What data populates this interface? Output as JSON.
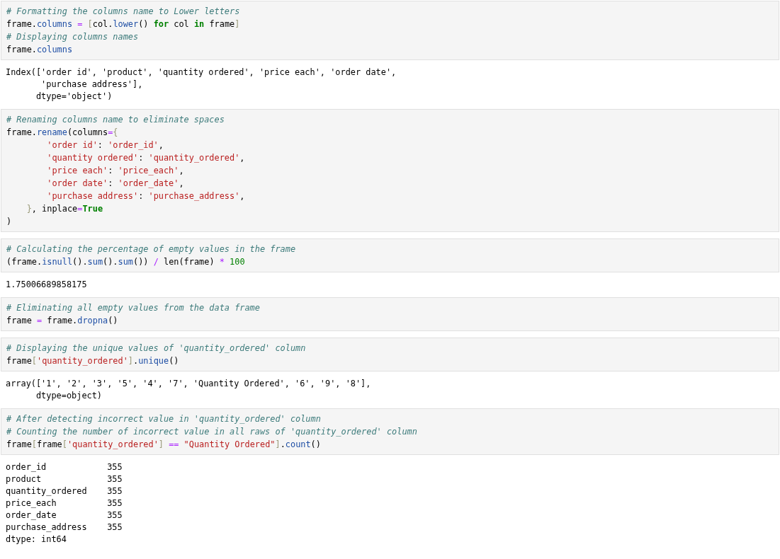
{
  "cells": [
    {
      "kind": "code",
      "lines": [
        [
          {
            "kind": "comment",
            "text": "# Formatting the columns name to Lower letters"
          }
        ],
        [
          {
            "kind": "text",
            "text": "frame."
          },
          {
            "kind": "attr",
            "text": "columns"
          },
          {
            "kind": "op",
            "text": " = "
          },
          {
            "kind": "bracket",
            "text": "["
          },
          {
            "kind": "text",
            "text": "col."
          },
          {
            "kind": "attr",
            "text": "lower"
          },
          {
            "kind": "text",
            "text": "() "
          },
          {
            "kind": "keyword",
            "text": "for"
          },
          {
            "kind": "text",
            "text": " col "
          },
          {
            "kind": "keyword",
            "text": "in"
          },
          {
            "kind": "text",
            "text": " frame"
          },
          {
            "kind": "bracket",
            "text": "]"
          }
        ],
        [
          {
            "kind": "comment",
            "text": "# Displaying columns names"
          }
        ],
        [
          {
            "kind": "text",
            "text": "frame."
          },
          {
            "kind": "attr",
            "text": "columns"
          }
        ]
      ]
    },
    {
      "kind": "output",
      "lines": [
        "Index(['order id', 'product', 'quantity ordered', 'price each', 'order date',",
        "       'purchase address'],",
        "      dtype='object')"
      ]
    },
    {
      "kind": "code",
      "lines": [
        [
          {
            "kind": "comment",
            "text": "# Renaming columns name to eliminate spaces"
          }
        ],
        [
          {
            "kind": "text",
            "text": "frame."
          },
          {
            "kind": "attr",
            "text": "rename"
          },
          {
            "kind": "text",
            "text": "(columns"
          },
          {
            "kind": "op",
            "text": "="
          },
          {
            "kind": "bracket",
            "text": "{"
          }
        ],
        [
          {
            "kind": "string",
            "text": "        'order id'"
          },
          {
            "kind": "text",
            "text": ": "
          },
          {
            "kind": "string",
            "text": "'order_id'"
          },
          {
            "kind": "text",
            "text": ","
          }
        ],
        [
          {
            "kind": "string",
            "text": "        'quantity ordered'"
          },
          {
            "kind": "text",
            "text": ": "
          },
          {
            "kind": "string",
            "text": "'quantity_ordered'"
          },
          {
            "kind": "text",
            "text": ","
          }
        ],
        [
          {
            "kind": "string",
            "text": "        'price each'"
          },
          {
            "kind": "text",
            "text": ": "
          },
          {
            "kind": "string",
            "text": "'price_each'"
          },
          {
            "kind": "text",
            "text": ","
          }
        ],
        [
          {
            "kind": "string",
            "text": "        'order date'"
          },
          {
            "kind": "text",
            "text": ": "
          },
          {
            "kind": "string",
            "text": "'order_date'"
          },
          {
            "kind": "text",
            "text": ","
          }
        ],
        [
          {
            "kind": "string",
            "text": "        'purchase address'"
          },
          {
            "kind": "text",
            "text": ": "
          },
          {
            "kind": "string",
            "text": "'purchase_address'"
          },
          {
            "kind": "text",
            "text": ","
          }
        ],
        [
          {
            "kind": "bracket",
            "text": "    }"
          },
          {
            "kind": "text",
            "text": ", inplace"
          },
          {
            "kind": "op",
            "text": "="
          },
          {
            "kind": "keyword",
            "text": "True"
          }
        ],
        [
          {
            "kind": "text",
            "text": ")"
          }
        ]
      ]
    },
    {
      "kind": "code",
      "lines": [
        [
          {
            "kind": "comment",
            "text": "# Calculating the percentage of empty values in the frame"
          }
        ],
        [
          {
            "kind": "text",
            "text": "(frame."
          },
          {
            "kind": "attr",
            "text": "isnull"
          },
          {
            "kind": "text",
            "text": "()."
          },
          {
            "kind": "attr",
            "text": "sum"
          },
          {
            "kind": "text",
            "text": "()."
          },
          {
            "kind": "attr",
            "text": "sum"
          },
          {
            "kind": "text",
            "text": "()) "
          },
          {
            "kind": "op",
            "text": "/"
          },
          {
            "kind": "text",
            "text": " len(frame) "
          },
          {
            "kind": "op",
            "text": "*"
          },
          {
            "kind": "number",
            "text": " 100"
          }
        ]
      ]
    },
    {
      "kind": "output",
      "lines": [
        "1.75006689858175"
      ]
    },
    {
      "kind": "code",
      "lines": [
        [
          {
            "kind": "comment",
            "text": "# Eliminating all empty values from the data frame"
          }
        ],
        [
          {
            "kind": "text",
            "text": "frame "
          },
          {
            "kind": "op",
            "text": "="
          },
          {
            "kind": "text",
            "text": " frame."
          },
          {
            "kind": "attr",
            "text": "dropna"
          },
          {
            "kind": "text",
            "text": "()"
          }
        ]
      ]
    },
    {
      "kind": "code",
      "lines": [
        [
          {
            "kind": "comment",
            "text": "# Displaying the unique values of 'quantity_ordered' column"
          }
        ],
        [
          {
            "kind": "text",
            "text": "frame"
          },
          {
            "kind": "bracket",
            "text": "["
          },
          {
            "kind": "string",
            "text": "'quantity_ordered'"
          },
          {
            "kind": "bracket",
            "text": "]"
          },
          {
            "kind": "text",
            "text": "."
          },
          {
            "kind": "attr",
            "text": "unique"
          },
          {
            "kind": "text",
            "text": "()"
          }
        ]
      ]
    },
    {
      "kind": "output",
      "lines": [
        "array(['1', '2', '3', '5', '4', '7', 'Quantity Ordered', '6', '9', '8'],",
        "      dtype=object)"
      ]
    },
    {
      "kind": "code",
      "lines": [
        [
          {
            "kind": "comment",
            "text": "# After detecting incorrect value in 'quantity_ordered' column"
          }
        ],
        [
          {
            "kind": "comment",
            "text": "# Counting the number of incorrect value in all raws of 'quantity_ordered' column"
          }
        ],
        [
          {
            "kind": "text",
            "text": "frame"
          },
          {
            "kind": "bracket",
            "text": "["
          },
          {
            "kind": "text",
            "text": "frame"
          },
          {
            "kind": "bracket",
            "text": "["
          },
          {
            "kind": "string",
            "text": "'quantity_ordered'"
          },
          {
            "kind": "bracket",
            "text": "]"
          },
          {
            "kind": "op",
            "text": " == "
          },
          {
            "kind": "string",
            "text": "\"Quantity Ordered\""
          },
          {
            "kind": "bracket",
            "text": "]"
          },
          {
            "kind": "text",
            "text": "."
          },
          {
            "kind": "attr",
            "text": "count"
          },
          {
            "kind": "text",
            "text": "()"
          }
        ]
      ]
    },
    {
      "kind": "output",
      "lines": [
        "order_id            355",
        "product             355",
        "quantity_ordered    355",
        "price_each          355",
        "order_date          355",
        "purchase_address    355",
        "dtype: int64"
      ]
    }
  ]
}
